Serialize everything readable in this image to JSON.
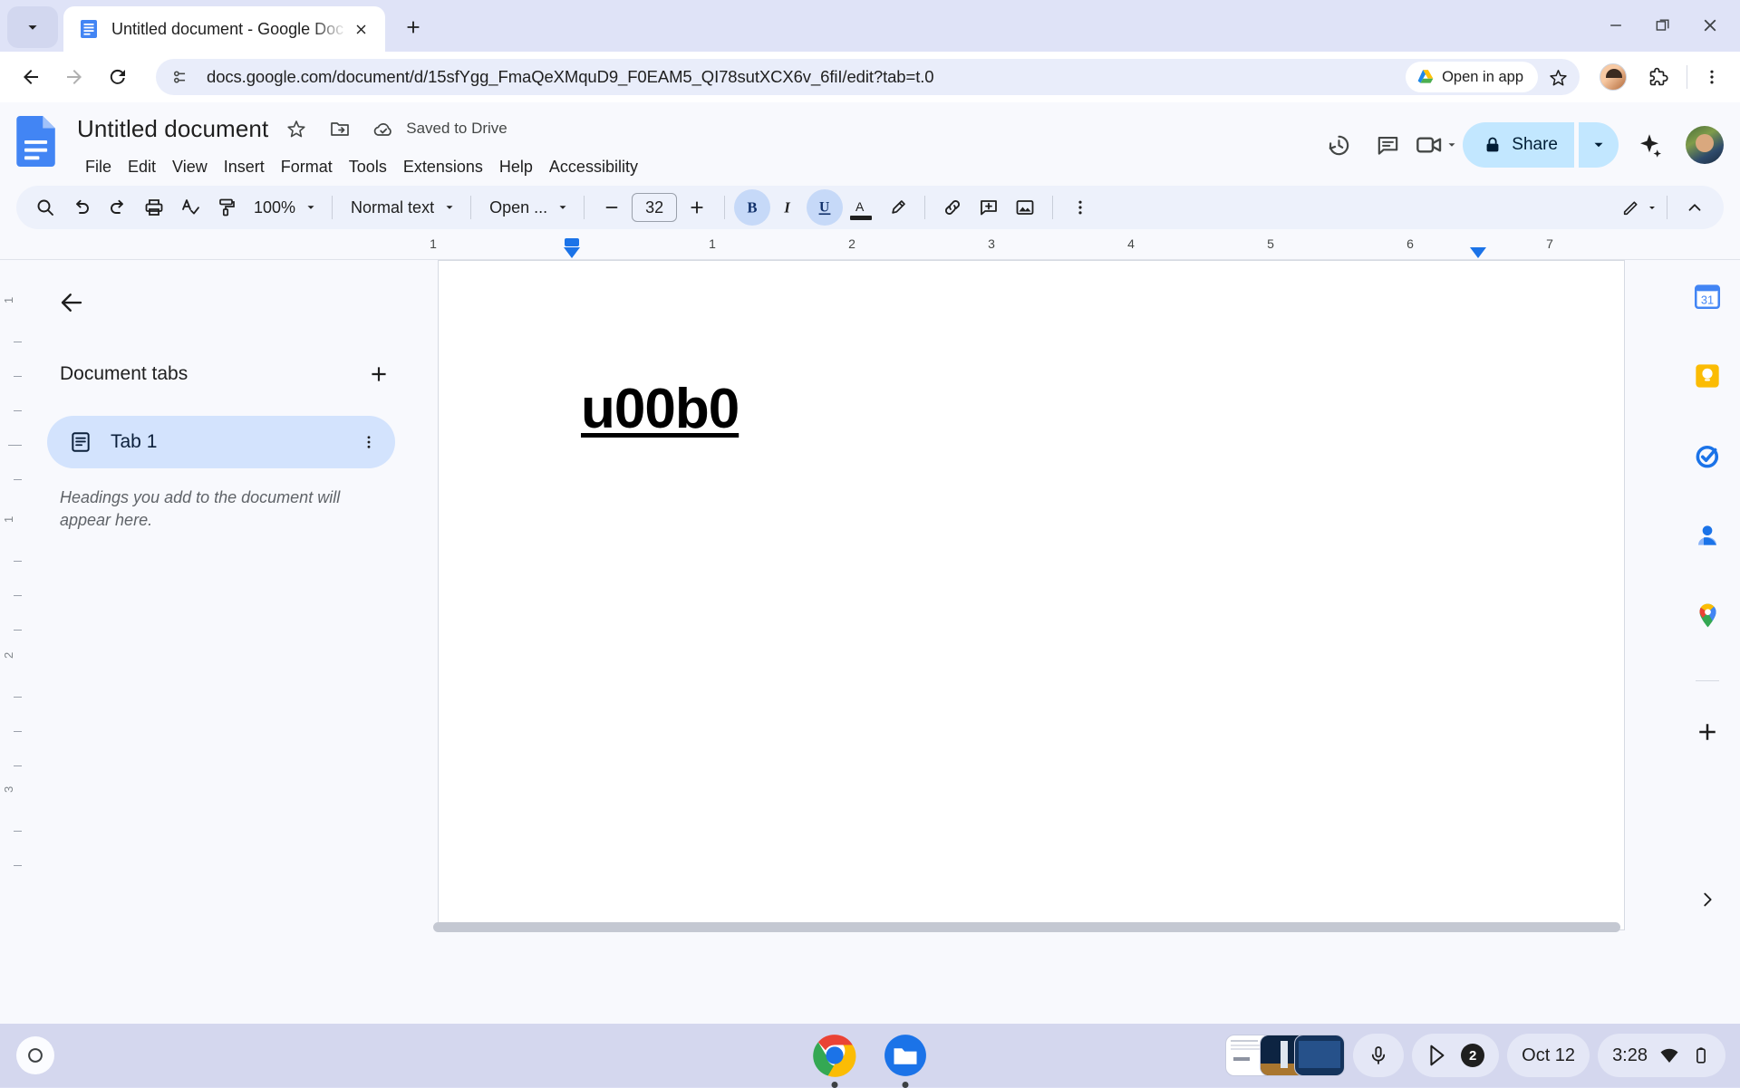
{
  "browser": {
    "tab": {
      "title": "Untitled document - Google Doc",
      "favicon": "google-docs-favicon"
    },
    "new_tab_label": "+",
    "url": "docs.google.com/document/d/15sfYgg_FmaQeXMquD9_F0EAM5_QI78sutXCX6v_6fiI/edit?tab=t.0",
    "open_in_app_label": "Open in app",
    "window_controls": [
      "minimize",
      "restore",
      "close"
    ]
  },
  "docs": {
    "title": "Untitled document",
    "save_state": "Saved to Drive",
    "menus": [
      "File",
      "Edit",
      "View",
      "Insert",
      "Format",
      "Tools",
      "Extensions",
      "Help",
      "Accessibility"
    ],
    "share_label": "Share",
    "header_icons": [
      "history-icon",
      "comment-icon",
      "meet-icon"
    ],
    "toolbar": {
      "zoom": "100%",
      "paragraph_style": "Normal text",
      "font": "Open ...",
      "font_size": "32",
      "decrease_label": "−",
      "increase_label": "+",
      "bold_active": true,
      "italic_active": false,
      "underline_active": true,
      "icons": [
        "search-icon",
        "undo-icon",
        "redo-icon",
        "print-icon",
        "spellcheck-icon",
        "paint-format-icon",
        "bold-icon",
        "italic-icon",
        "underline-icon",
        "text-color-icon",
        "highlight-icon",
        "link-icon",
        "comment-add-icon",
        "insert-image-icon",
        "more-options-icon",
        "editing-mode-icon",
        "collapse-toolbar-icon"
      ]
    },
    "ruler": {
      "numbers": [
        "1",
        "1",
        "2",
        "3",
        "4",
        "5",
        "6",
        "7"
      ],
      "vertical_numbers": [
        "1",
        "1",
        "2",
        "3"
      ]
    },
    "tabs_pane": {
      "heading": "Document tabs",
      "add_label": "+",
      "tabs": [
        {
          "label": "Tab 1",
          "icon": "document-tab-icon"
        }
      ],
      "hint": "Headings you add to the document will appear here."
    },
    "document_text": "u00b0",
    "rail_icons": [
      "calendar-icon",
      "keep-icon",
      "tasks-icon",
      "contacts-icon",
      "maps-icon",
      "add-on-icon"
    ]
  },
  "shelf": {
    "apps": [
      "chrome-icon",
      "files-icon"
    ],
    "date": "Oct 12",
    "time": "3:28",
    "notification_count": "2",
    "status_icons": [
      "microphone-icon",
      "play-store-icon",
      "wifi-icon",
      "battery-icon"
    ]
  },
  "colors": {
    "accent": "#1b73e8",
    "share_bg": "#c2e7ff",
    "tab_chip_bg": "#d3e3fd",
    "toolbar_bg": "#edf1fb",
    "shelf_bg": "#d4d7ee"
  }
}
